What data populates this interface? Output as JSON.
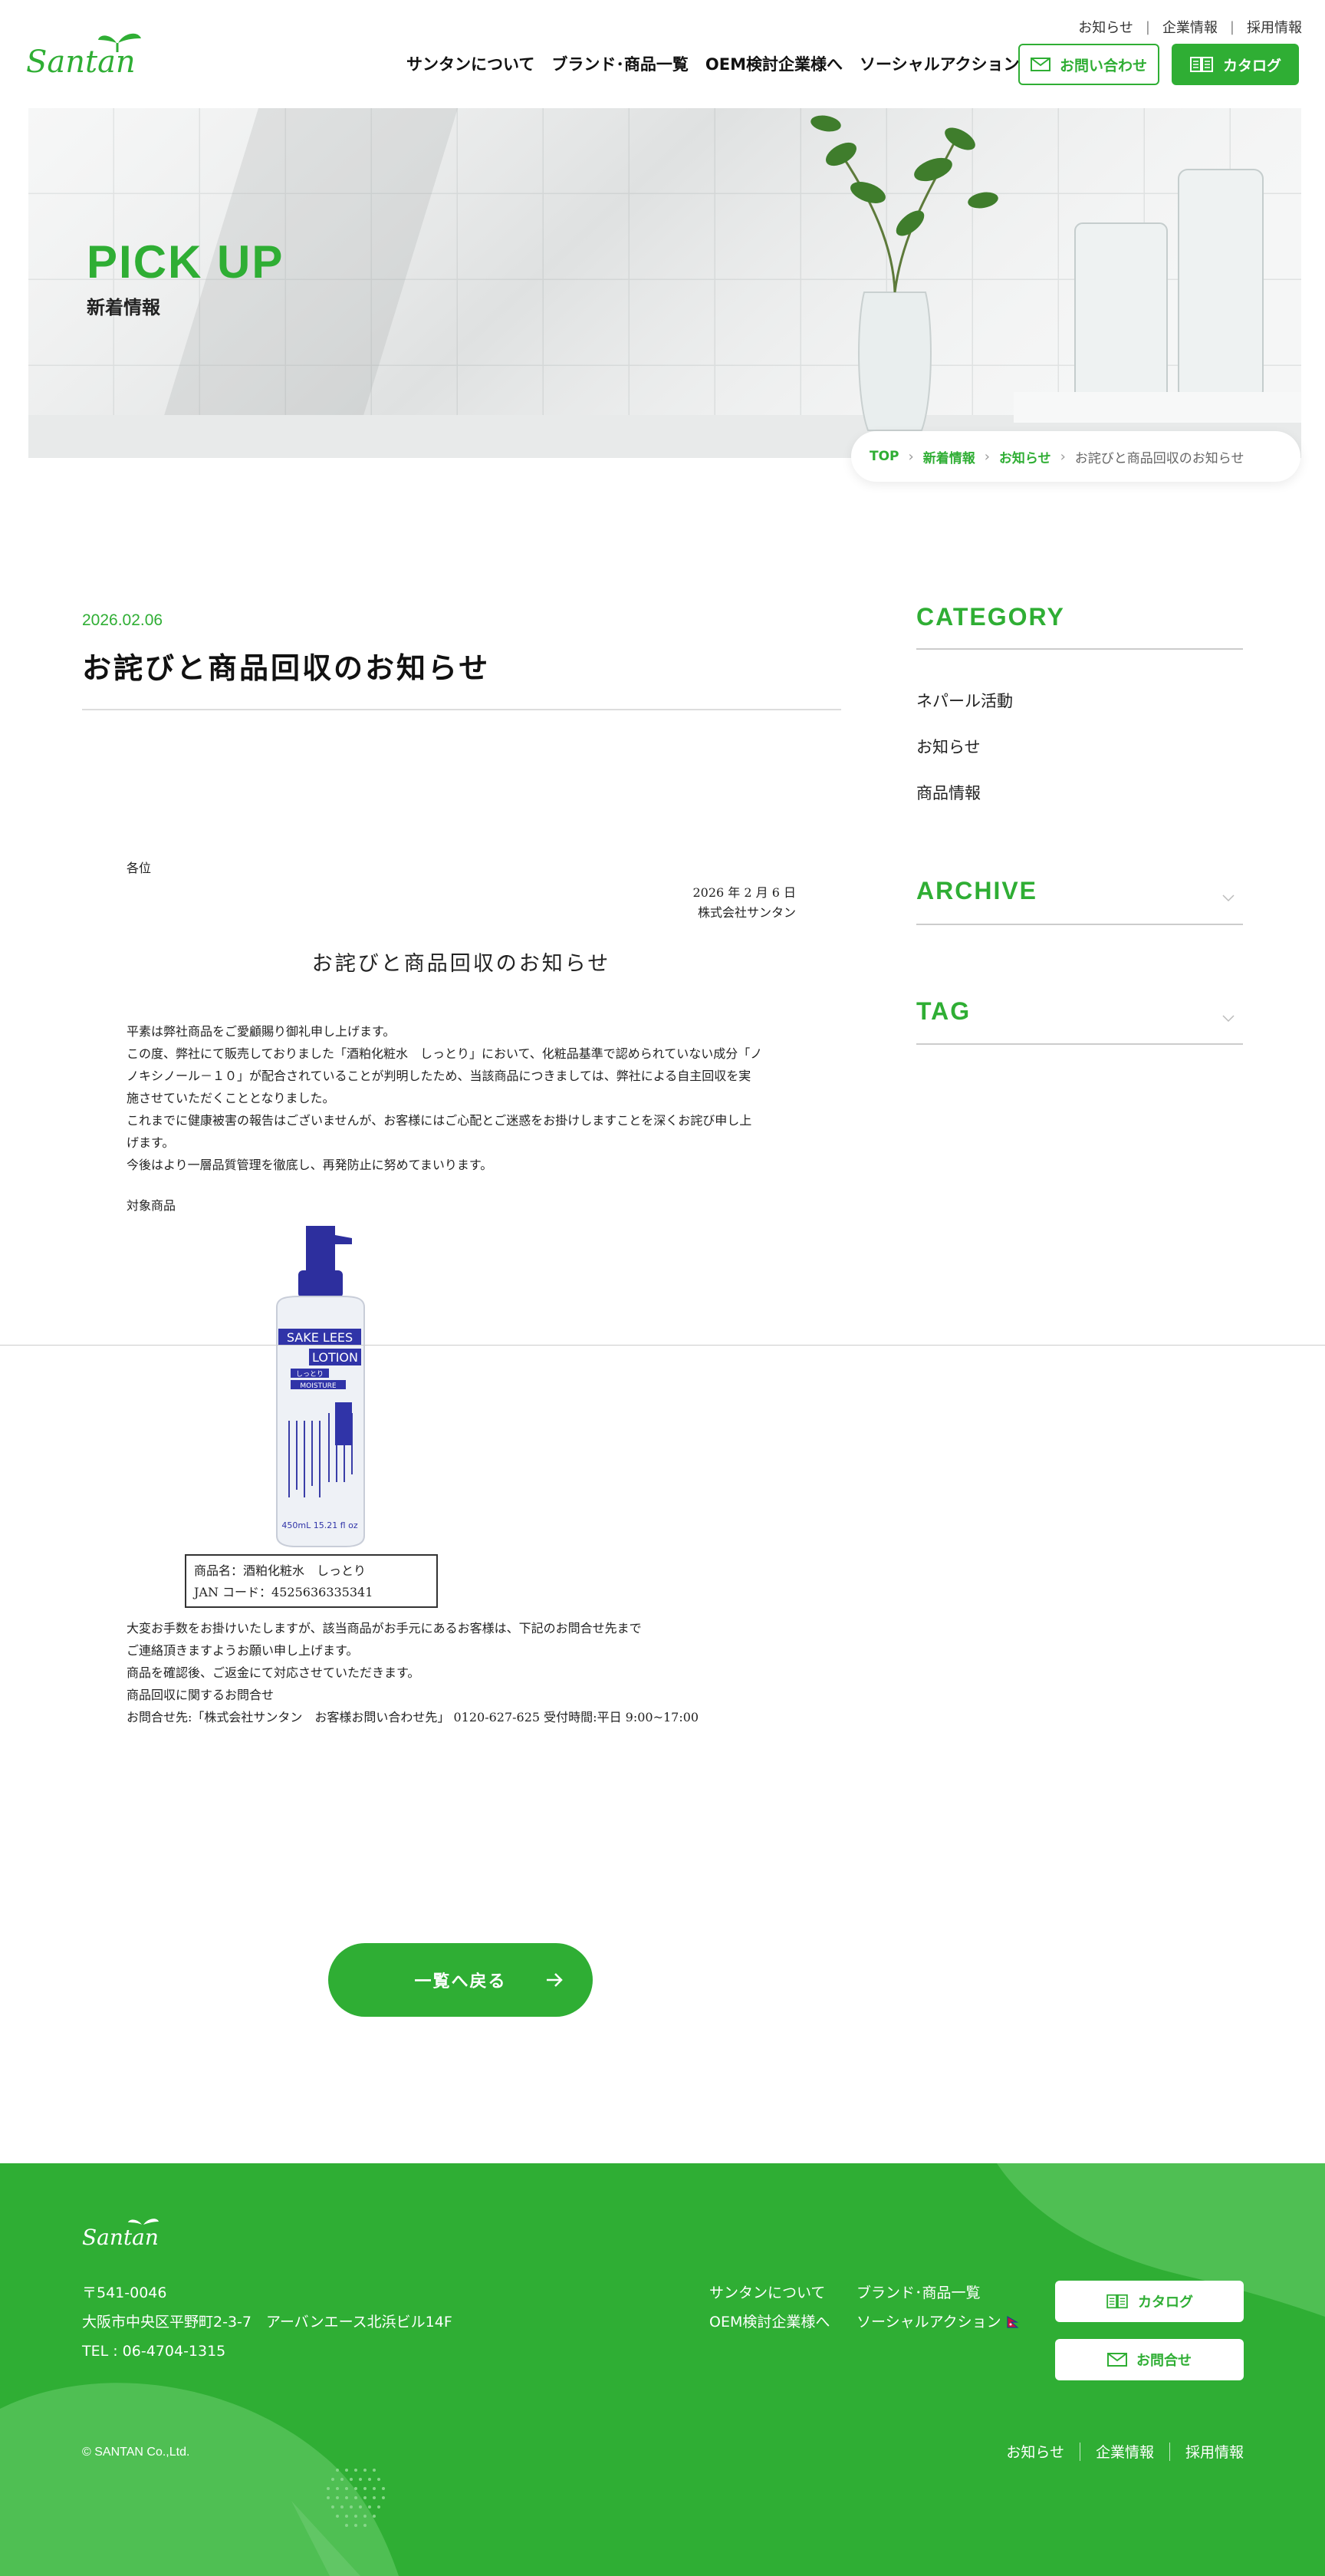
{
  "header": {
    "logo_text": "Santan",
    "util_links": [
      "お知らせ",
      "企業情報",
      "採用情報"
    ],
    "nav": [
      {
        "label": "サンタンについて"
      },
      {
        "label": "ブランド･商品一覧"
      },
      {
        "label": "OEM検討企業様へ"
      },
      {
        "label": "ソーシャルアクション"
      }
    ],
    "contact_label": "お問い合わせ",
    "catalog_label": "カタログ"
  },
  "hero": {
    "title": "PICK UP",
    "subtitle": "新着情報"
  },
  "breadcrumb": {
    "items": [
      "TOP",
      "新着情報",
      "お知らせ"
    ],
    "current": "お詫びと商品回収のお知らせ"
  },
  "post": {
    "date": "2026.02.06",
    "title": "お詫びと商品回収のお知らせ"
  },
  "document": {
    "to": "各位",
    "date": "2026 年 2 月 6 日",
    "company": "株式会社サンタン",
    "heading": "お詫びと商品回収のお知らせ",
    "body": [
      "平素は弊社商品をご愛顧賜り御礼申し上げます。",
      "この度、弊社にて販売しておりました「酒粕化粧水　しっとり」において、化粧品基準で認められていない成分「ノ",
      "ノキシノール－１０」が配合されていることが判明したため、当該商品につきましては、弊社による自主回収を実",
      "施させていただくこととなりました。",
      "これまでに健康被害の報告はございませんが、お客様にはご心配とご迷惑をお掛けしますことを深くお詫び申し上",
      "げます。",
      "今後はより一層品質管理を徹底し、再発防止に努めてまいります。"
    ],
    "target_label": "対象商品",
    "product_label_lines": [
      "SAKE LEES",
      "LOTION",
      "しっとり",
      "MOISTURE"
    ],
    "product_volume": "450mL 15.21 fl oz",
    "product_name": "商品名：酒粕化粧水　しっとり",
    "product_jan": "JAN コード：4525636335341",
    "after": [
      "大変お手数をお掛けいたしますが、該当商品がお手元にあるお客様は、下記のお問合せ先まで",
      "ご連絡頂きますようお願い申し上げます。",
      "商品を確認後、ご返金にて対応させていただきます。",
      "商品回収に関するお問合せ",
      "お問合せ先:「株式会社サンタン　お客様お問い合わせ先」 0120-627-625  受付時間:平日 9:00~17:00"
    ]
  },
  "back_button": "一覧へ戻る",
  "sidebar": {
    "category_title": "CATEGORY",
    "categories": [
      "ネパール活動",
      "お知らせ",
      "商品情報"
    ],
    "archive_title": "ARCHIVE",
    "tag_title": "TAG"
  },
  "footer": {
    "logo_text": "Santan",
    "address": [
      "〒541-0046",
      "大阪市中央区平野町2-3-7　アーバンエース北浜ビル14F",
      "TEL : 06-4704-1315"
    ],
    "nav": [
      [
        "サンタンについて",
        "ブランド･商品一覧"
      ],
      [
        "OEM検討企業様へ",
        "ソーシャルアクション"
      ]
    ],
    "catalog_label": "カタログ",
    "contact_label": "お問合せ",
    "copyright": "© SANTAN Co.,Ltd.",
    "util_links": [
      "お知らせ",
      "企業情報",
      "採用情報"
    ]
  },
  "colors": {
    "brand_green": "#2fae34",
    "footer_green": "#2fae34"
  }
}
